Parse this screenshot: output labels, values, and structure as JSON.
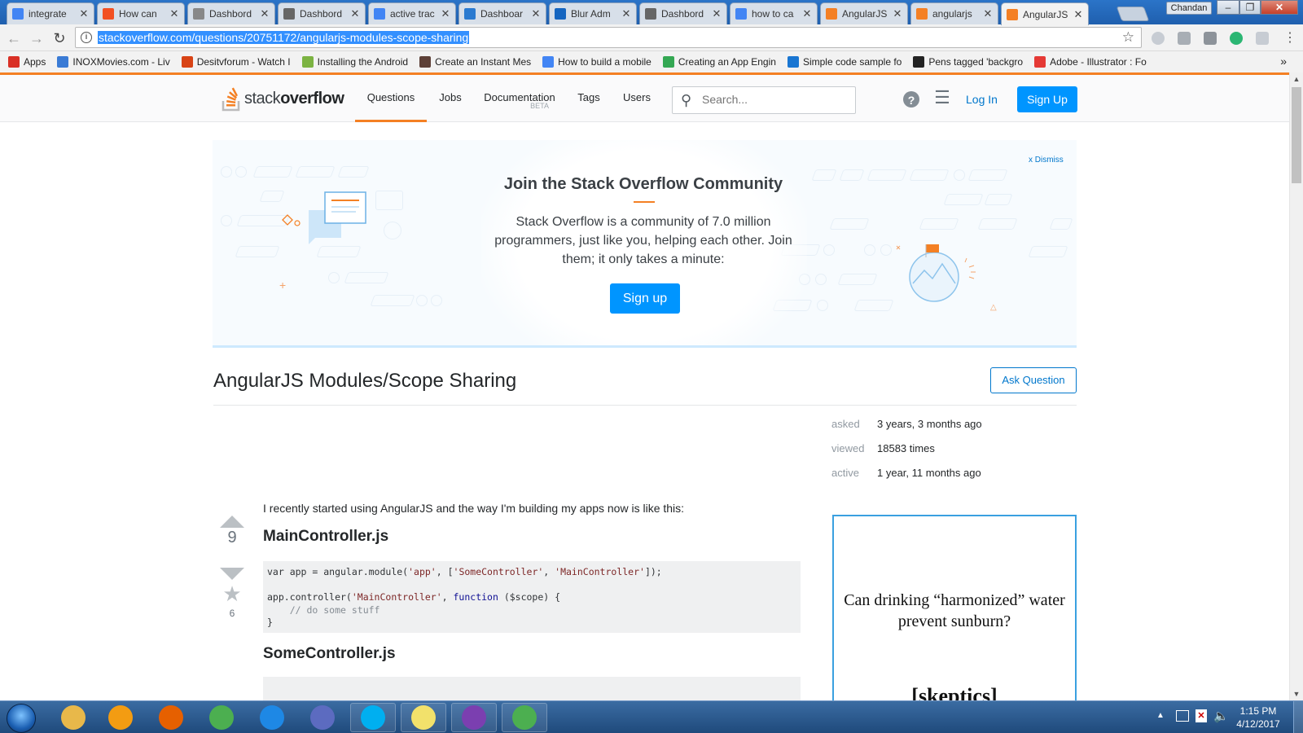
{
  "browser": {
    "tabs": [
      {
        "title": "integrate",
        "icon": "google-icon",
        "color": "#4285f4"
      },
      {
        "title": "How can",
        "icon": "windows-icon",
        "color": "#f25022"
      },
      {
        "title": "Dashbord",
        "icon": "tool-icon",
        "color": "#888888"
      },
      {
        "title": "Dashbord",
        "icon": "document-icon",
        "color": "#666666"
      },
      {
        "title": "active trac",
        "icon": "google-icon",
        "color": "#4285f4"
      },
      {
        "title": "Dashboar",
        "icon": "star-app-icon",
        "color": "#2a7ad0"
      },
      {
        "title": "Blur Adm",
        "icon": "chart-icon",
        "color": "#1565c0"
      },
      {
        "title": "Dashbord",
        "icon": "document-icon",
        "color": "#666666"
      },
      {
        "title": "how to ca",
        "icon": "google-icon",
        "color": "#4285f4"
      },
      {
        "title": "AngularJS",
        "icon": "stackoverflow-icon",
        "color": "#f48024"
      },
      {
        "title": "angularjs",
        "icon": "stackoverflow-icon",
        "color": "#f48024"
      },
      {
        "title": "AngularJS",
        "icon": "stackoverflow-icon",
        "color": "#f48024"
      }
    ],
    "active_tab_index": 11,
    "user": "Chandan",
    "url": "stackoverflow.com/questions/20751172/angularjs-modules-scope-sharing",
    "bookmarks": [
      {
        "label": "Apps",
        "icon": "apps-grid-icon",
        "color": "#d93025"
      },
      {
        "label": "INOXMovies.com - Liv",
        "icon": "globe-icon",
        "color": "#3a7bd5"
      },
      {
        "label": "Desitvforum - Watch I",
        "icon": "dtf-icon",
        "color": "#d84315"
      },
      {
        "label": "Installing the Android",
        "icon": "android-icon",
        "color": "#7cb342"
      },
      {
        "label": "Create an Instant Mes",
        "icon": "page-icon",
        "color": "#5d4037"
      },
      {
        "label": "How to build a mobile",
        "icon": "circle-logo-icon",
        "color": "#4285f4"
      },
      {
        "label": "Creating an App Engin",
        "icon": "app-engine-icon",
        "color": "#34a853"
      },
      {
        "label": "Simple code sample fo",
        "icon": "grid-logo-icon",
        "color": "#1976d2"
      },
      {
        "label": "Pens tagged 'backgro",
        "icon": "codepen-icon",
        "color": "#222222"
      },
      {
        "label": "Adobe - Illustrator : Fo",
        "icon": "adobe-icon",
        "color": "#e53935"
      }
    ]
  },
  "site": {
    "logo_text_light": "stack",
    "logo_text_bold": "overflow",
    "nav": [
      "Questions",
      "Jobs",
      "Documentation",
      "Tags",
      "Users"
    ],
    "nav_beta": "BETA",
    "search_placeholder": "Search...",
    "login": "Log In",
    "signup": "Sign Up",
    "accent": "#f48024",
    "blue": "#0095ff"
  },
  "banner": {
    "dismiss": "x Dismiss",
    "title": "Join the Stack Overflow Community",
    "text": "Stack Overflow is a community of 7.0 million programmers, just like you, helping each other. Join them; it only takes a minute:",
    "signup": "Sign up"
  },
  "question": {
    "title": "AngularJS Modules/Scope Sharing",
    "ask_button": "Ask Question",
    "meta": [
      {
        "label": "asked",
        "value": "3 years, 3 months ago"
      },
      {
        "label": "viewed",
        "value": "18583 times"
      },
      {
        "label": "active",
        "value": "1 year, 11 months ago"
      }
    ],
    "votes": "9",
    "favorites": "6",
    "intro": "I recently started using AngularJS and the way I'm building my apps now is like this:",
    "heading1": "MainController.js",
    "heading2": "SomeController.js",
    "code1": {
      "line1_a": "var app = angular.",
      "line1_b": "module",
      "line1_c": "(",
      "line1_s1": "'app'",
      "line1_d": ", [",
      "line1_s2": "'SomeController'",
      "line1_e": ", ",
      "line1_s3": "'MainController'",
      "line1_f": "]);",
      "line3_a": "app.controller(",
      "line3_s": "'MainController'",
      "line3_b": ", ",
      "line3_kw": "function",
      "line3_c": " ($scope) {",
      "line4": "    // do some stuff",
      "line5": "}"
    }
  },
  "ad": {
    "text": "Can drinking “harmonized” water prevent sunburn?",
    "brand": "[skeptics]"
  },
  "taskbar": {
    "apps": [
      {
        "name": "explorer-icon",
        "color": "#e8b84a"
      },
      {
        "name": "media-player-icon",
        "color": "#f39c12"
      },
      {
        "name": "firefox-icon",
        "color": "#e66000"
      },
      {
        "name": "chrome-icon",
        "color": "#4caf50"
      },
      {
        "name": "internet-explorer-icon",
        "color": "#1e88e5"
      },
      {
        "name": "remote-desktop-icon",
        "color": "#5c6bc0"
      },
      {
        "name": "skype-icon",
        "color": "#00aff0"
      },
      {
        "name": "sticky-notes-icon",
        "color": "#f2e16b"
      },
      {
        "name": "visual-studio-icon",
        "color": "#7b3fb0"
      },
      {
        "name": "chrome-icon",
        "color": "#4caf50"
      }
    ],
    "time": "1:15 PM",
    "date": "4/12/2017"
  }
}
